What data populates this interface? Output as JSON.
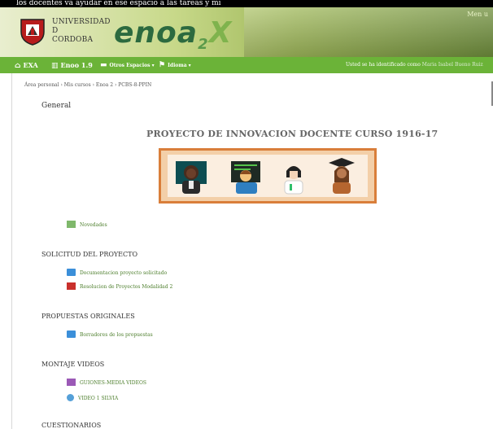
{
  "caption": "los docentes va ayudar en ese espacio a las tareas y mi",
  "header": {
    "university": [
      "UNIVERSIDAD",
      "D",
      "CORDOBA"
    ],
    "logo_main": "enoa",
    "logo_sub": "2",
    "logo_x": "X",
    "top_right": "Men u"
  },
  "nav": {
    "items": [
      {
        "icon": "home-icon",
        "label": "EXA"
      },
      {
        "icon": "institution-icon",
        "label": "Enoo 1.9"
      },
      {
        "icon": "car-icon",
        "label": "Otros Espacios ▾"
      },
      {
        "icon": "flag-icon",
        "label": "Idioma ▾"
      }
    ],
    "user_prefix": "Usted se ha identificado como ",
    "user_name": "Maria Isabel Bueno Ruiz"
  },
  "breadcrumb": "Área personal › Mis cursos › Enoa 2 › PCBS-8-PPIN",
  "sections": {
    "general": "General",
    "project_title": "PROYECTO DE INNOVACION DOCENTE CURSO 1916-17",
    "news": "Novedades",
    "solicitud": {
      "title": "SOLICITUD DEL PROYECTO",
      "items": [
        "Documentacion proyecto solicitado",
        "Resolucion de Proyectos Modalidad 2"
      ]
    },
    "propuestas": {
      "title": "PROPUESTAS ORIGINALES",
      "items": [
        "Borradores de los propuestas"
      ]
    },
    "montaje": {
      "title": "MONTAJE VIDEOS",
      "items": [
        "GUIONES-MEDIA VIDEOS",
        "VIDEO 1 SILVIA"
      ]
    },
    "cuestionarios": "CUESTIONARIOS"
  },
  "colors": {
    "navbar": "#6bb338",
    "panel_border": "#d97e3a",
    "panel_fill": "#f3cfa8"
  }
}
